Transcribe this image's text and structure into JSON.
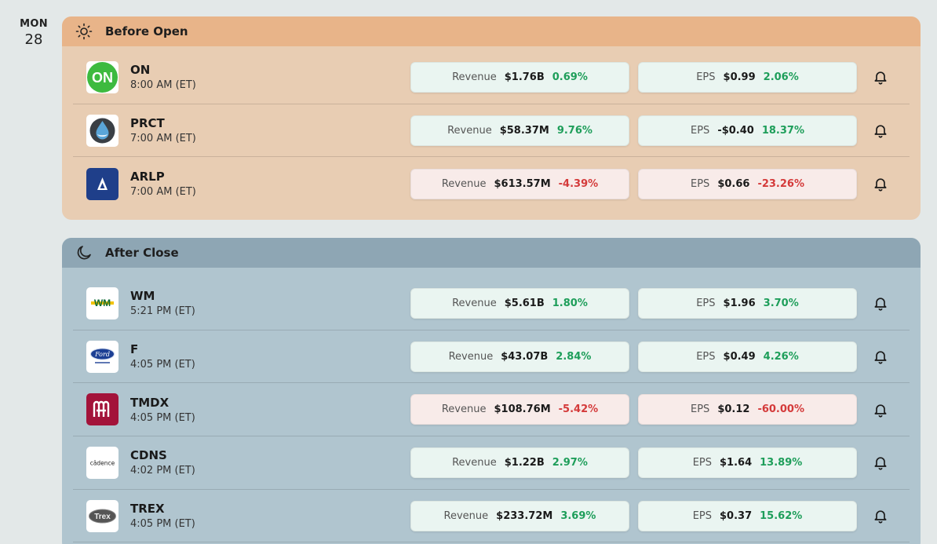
{
  "date": {
    "dow": "MON",
    "day": "28"
  },
  "sections": [
    {
      "title": "Before Open",
      "icon": "sun-icon",
      "rows": [
        {
          "ticker": "ON",
          "time": "8:00 AM (ET)",
          "logo": "onsemi-logo",
          "logo_text": "ON",
          "revenue": {
            "label": "Revenue",
            "value": "$1.76B",
            "change": "0.69%",
            "trend": "pos"
          },
          "eps": {
            "label": "EPS",
            "value": "$0.99",
            "change": "2.06%",
            "trend": "pos"
          }
        },
        {
          "ticker": "PRCT",
          "time": "7:00 AM (ET)",
          "logo": "procept-logo",
          "logo_text": "",
          "revenue": {
            "label": "Revenue",
            "value": "$58.37M",
            "change": "9.76%",
            "trend": "pos"
          },
          "eps": {
            "label": "EPS",
            "value": "-$0.40",
            "change": "18.37%",
            "trend": "pos"
          }
        },
        {
          "ticker": "ARLP",
          "time": "7:00 AM (ET)",
          "logo": "arlp-logo",
          "logo_text": "",
          "revenue": {
            "label": "Revenue",
            "value": "$613.57M",
            "change": "-4.39%",
            "trend": "neg"
          },
          "eps": {
            "label": "EPS",
            "value": "$0.66",
            "change": "-23.26%",
            "trend": "neg"
          }
        }
      ]
    },
    {
      "title": "After Close",
      "icon": "moon-icon",
      "rows": [
        {
          "ticker": "WM",
          "time": "5:21 PM (ET)",
          "logo": "wm-logo",
          "logo_text": "WM",
          "revenue": {
            "label": "Revenue",
            "value": "$5.61B",
            "change": "1.80%",
            "trend": "pos"
          },
          "eps": {
            "label": "EPS",
            "value": "$1.96",
            "change": "3.70%",
            "trend": "pos"
          }
        },
        {
          "ticker": "F",
          "time": "4:05 PM (ET)",
          "logo": "ford-logo",
          "logo_text": "Ford",
          "revenue": {
            "label": "Revenue",
            "value": "$43.07B",
            "change": "2.84%",
            "trend": "pos"
          },
          "eps": {
            "label": "EPS",
            "value": "$0.49",
            "change": "4.26%",
            "trend": "pos"
          }
        },
        {
          "ticker": "TMDX",
          "time": "4:05 PM (ET)",
          "logo": "tmdx-logo",
          "logo_text": "",
          "revenue": {
            "label": "Revenue",
            "value": "$108.76M",
            "change": "-5.42%",
            "trend": "neg"
          },
          "eps": {
            "label": "EPS",
            "value": "$0.12",
            "change": "-60.00%",
            "trend": "neg"
          }
        },
        {
          "ticker": "CDNS",
          "time": "4:02 PM (ET)",
          "logo": "cadence-logo",
          "logo_text": "cādence",
          "revenue": {
            "label": "Revenue",
            "value": "$1.22B",
            "change": "2.97%",
            "trend": "pos"
          },
          "eps": {
            "label": "EPS",
            "value": "$1.64",
            "change": "13.89%",
            "trend": "pos"
          }
        },
        {
          "ticker": "TREX",
          "time": "4:05 PM (ET)",
          "logo": "trex-logo",
          "logo_text": "Trex",
          "revenue": {
            "label": "Revenue",
            "value": "$233.72M",
            "change": "3.69%",
            "trend": "pos"
          },
          "eps": {
            "label": "EPS",
            "value": "$0.37",
            "change": "15.62%",
            "trend": "pos"
          }
        }
      ]
    }
  ],
  "colors": {
    "positive": "#1e9e5a",
    "negative": "#d43a3a",
    "before_header": "#e8b489",
    "after_header": "#8ea6b4"
  }
}
